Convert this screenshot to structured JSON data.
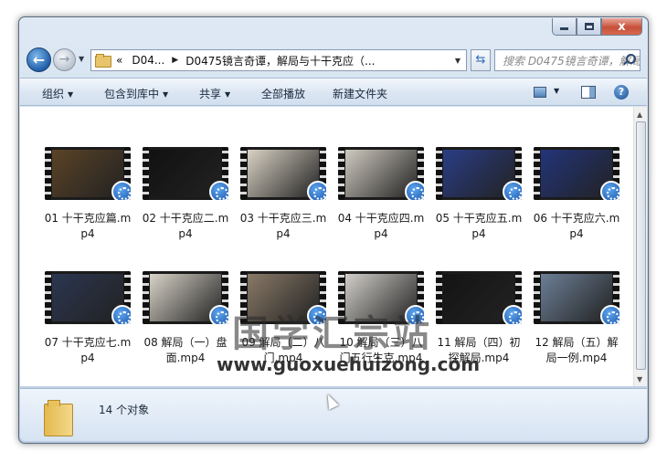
{
  "window": {
    "caption_close": "x"
  },
  "nav": {
    "back_arrow": "←",
    "forward_arrow": "→",
    "breadcrumb": [
      "«",
      "D04...",
      "D0475镜言奇谭，解局与十干克应（..."
    ],
    "search_placeholder": "搜索 D0475镜言奇谭，解局与十..."
  },
  "toolbar": {
    "organize": "组织",
    "include_in_library": "包含到库中",
    "share": "共享",
    "play_all": "全部播放",
    "new_folder": "新建文件夹"
  },
  "files": [
    {
      "name": "01 十干克应篇.mp4",
      "frame_color": "#5b4326"
    },
    {
      "name": "02 十干克应二.mp4",
      "frame_color": "#111111"
    },
    {
      "name": "03 十干克应三.mp4",
      "frame_color": "#d9d2c4"
    },
    {
      "name": "04 十干克应四.mp4",
      "frame_color": "#cfcac0"
    },
    {
      "name": "05 十干克应五.mp4",
      "frame_color": "#2a3d86"
    },
    {
      "name": "06 十干克应六.mp4",
      "frame_color": "#23347a"
    },
    {
      "name": "07 十干克应七.mp4",
      "frame_color": "#2b3650"
    },
    {
      "name": "08 解局（一）盘面.mp4",
      "frame_color": "#d8d3c8"
    },
    {
      "name": "09 解局（二）八门.mp4",
      "frame_color": "#8a7a68"
    },
    {
      "name": "10 解局（三）八门五行生克.mp4",
      "frame_color": "#d2cfca"
    },
    {
      "name": "11 解局（四）初探解局.mp4",
      "frame_color": "#141414"
    },
    {
      "name": "12 解局（五）解局一例.mp4",
      "frame_color": "#6c7f96"
    }
  ],
  "watermark": {
    "title": "国学汇宗站",
    "url": "www.guoxuehuizong.com"
  },
  "details": {
    "item_count": "14 个对象"
  }
}
